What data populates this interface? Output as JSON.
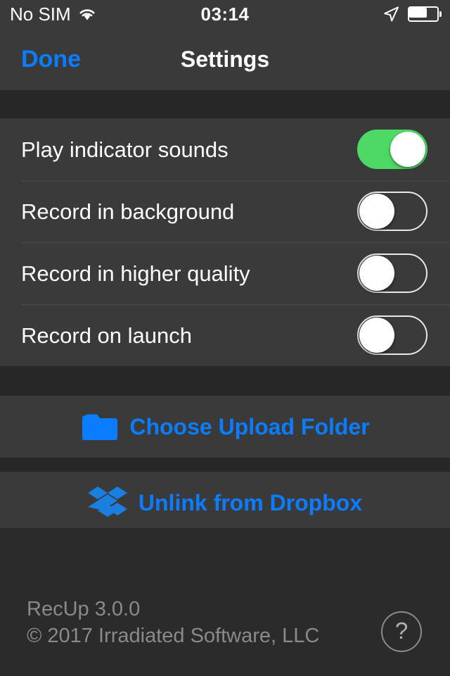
{
  "status_bar": {
    "carrier": "No SIM",
    "wifi_icon": "wifi-icon",
    "time": "03:14",
    "location_icon": "location-arrow-icon",
    "battery_icon": "battery-icon",
    "battery_level_percent": 62
  },
  "nav_bar": {
    "done_label": "Done",
    "title": "Settings",
    "accent_color": "#0a7cff"
  },
  "settings": {
    "toggles": [
      {
        "label": "Play indicator sounds",
        "value": "on"
      },
      {
        "label": "Record in background",
        "value": "off"
      },
      {
        "label": "Record in higher quality",
        "value": "off"
      },
      {
        "label": "Record on launch",
        "value": "off"
      }
    ],
    "switch_on_color": "#4cd964",
    "switch_off_color": "#3a3a3a"
  },
  "actions": [
    {
      "label": "Choose Upload Folder",
      "icon": "folder-icon"
    },
    {
      "label": "Unlink from Dropbox",
      "icon": "dropbox-icon"
    }
  ],
  "footer": {
    "app_version": "RecUp 3.0.0",
    "copyright": "© 2017 Irradiated Software, LLC",
    "help_label": "?"
  }
}
